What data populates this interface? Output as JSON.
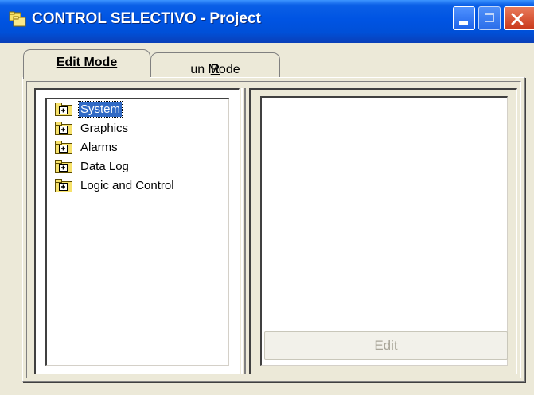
{
  "window": {
    "title": "CONTROL SELECTIVO - Project",
    "controls": {
      "minimize_icon": "minimize-icon",
      "maximize_icon": "maximize-icon",
      "close_icon": "close-icon"
    },
    "title_bar_color": "#0054e3"
  },
  "tabs": [
    {
      "label": "Edit Mode",
      "active": true
    },
    {
      "label_prefix": "",
      "label_mnemonic": "R",
      "label_rest": "un Mode",
      "active": false
    }
  ],
  "tree": {
    "items": [
      {
        "label": "System",
        "selected": true,
        "icon": "folder-plus-icon"
      },
      {
        "label": "Graphics",
        "selected": false,
        "icon": "folder-plus-icon"
      },
      {
        "label": "Alarms",
        "selected": false,
        "icon": "folder-plus-icon"
      },
      {
        "label": "Data Log",
        "selected": false,
        "icon": "folder-plus-icon"
      },
      {
        "label": "Logic and Control",
        "selected": false,
        "icon": "folder-plus-icon"
      }
    ]
  },
  "detail_panel": {
    "edit_button": {
      "label": "Edit",
      "enabled": false
    }
  },
  "colors": {
    "window_bg": "#ece9d8",
    "selection": "#316ac5",
    "folder": "#f7e26b"
  }
}
